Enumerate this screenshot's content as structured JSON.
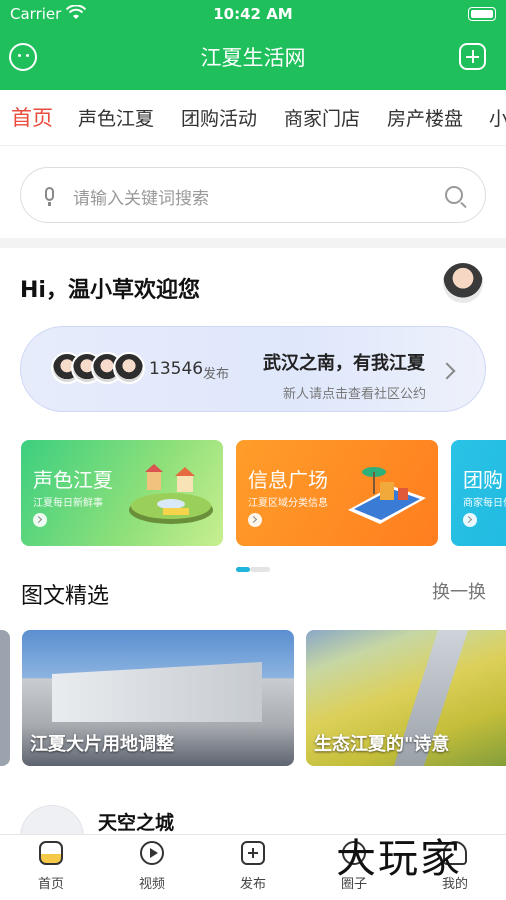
{
  "status_bar": {
    "carrier": "Carrier",
    "time": "10:42 AM"
  },
  "header": {
    "title": "江夏生活网"
  },
  "tabs": [
    {
      "label": "首页",
      "active": true
    },
    {
      "label": "声色江夏"
    },
    {
      "label": "团购活动"
    },
    {
      "label": "商家门店"
    },
    {
      "label": "房产楼盘"
    },
    {
      "label": "小"
    }
  ],
  "search": {
    "placeholder": "请输入关键词搜索"
  },
  "greeting": "Hi，温小草欢迎您",
  "community": {
    "count": "13546",
    "count_suffix": "发布",
    "motto": "武汉之南，有我江夏",
    "subtitle": "新人请点击查看社区公约"
  },
  "feature_cards": [
    {
      "title": "声色江夏",
      "subtitle": "江夏每日新鲜事",
      "color": "#3ccf7f"
    },
    {
      "title": "信息广场",
      "subtitle": "江夏区域分类信息",
      "color": "#ff8a24"
    },
    {
      "title": "团购",
      "subtitle": "商家每日优",
      "color": "#1fb4d9"
    }
  ],
  "carousel": {
    "active_index": 0,
    "count": 2
  },
  "section": {
    "title": "图文精选",
    "refresh_label": "换一换"
  },
  "articles": [
    {
      "label": "江夏大片用地调整"
    },
    {
      "label": "生态江夏的\"诗意"
    }
  ],
  "post": {
    "title": "天空之城"
  },
  "tabbar": [
    {
      "label": "首页",
      "icon": "home-icon",
      "active": true
    },
    {
      "label": "视频",
      "icon": "video-icon"
    },
    {
      "label": "发布",
      "icon": "add-icon"
    },
    {
      "label": "圈子",
      "icon": "circle-icon"
    },
    {
      "label": "我的",
      "icon": "profile-icon"
    }
  ],
  "watermark": "大玩家"
}
